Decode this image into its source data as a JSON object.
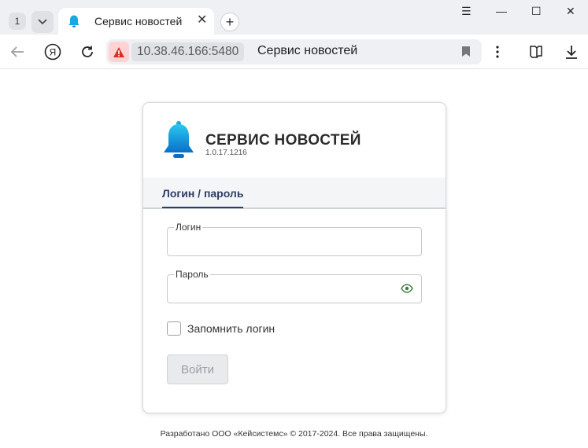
{
  "browser": {
    "tab_count": "1",
    "tab_title": "Сервис новостей",
    "host": "10.38.46.166:5480",
    "omnibox_title": "Сервис новостей",
    "yandex_glyph": "Я"
  },
  "app": {
    "title": "СЕРВИС НОВОСТЕЙ",
    "version": "1.0.17.1216"
  },
  "auth_tabs": {
    "active_label": "Логин / пароль"
  },
  "form": {
    "login_label": "Логин",
    "login_value": "",
    "password_label": "Пароль",
    "password_value": "",
    "remember_label": "Запомнить логин",
    "remember_checked": false,
    "submit_label": "Войти"
  },
  "footer": {
    "text": "Разработано ООО «Кейсистемс» © 2017-2024. Все права защищены."
  },
  "colors": {
    "accent": "#2c3e66",
    "bell_gradient_top": "#29c8f0",
    "bell_gradient_bottom": "#0a6fc7",
    "warning": "#d93025",
    "eye": "#3b7a3b"
  }
}
